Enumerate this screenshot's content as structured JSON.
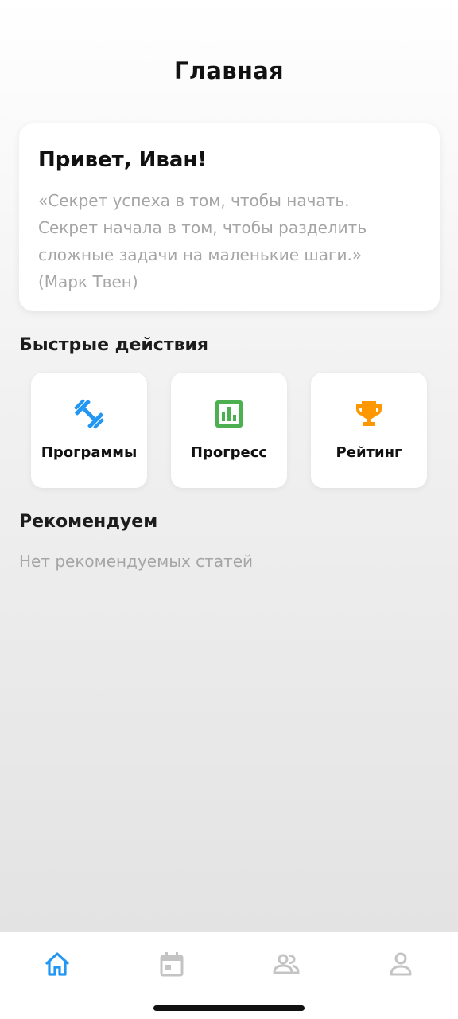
{
  "header": {
    "title": "Главная"
  },
  "greeting": {
    "title": "Привет, Иван!",
    "quote": "«Секрет успеха в том, чтобы начать. Секрет начала в том, чтобы разделить сложные задачи на маленькие шаги.» (Марк Твен)"
  },
  "quick_actions": {
    "title": "Быстрые действия",
    "items": [
      {
        "label": "Программы",
        "icon": "dumbbell-icon",
        "color": "#2196F3"
      },
      {
        "label": "Прогресс",
        "icon": "bar-chart-icon",
        "color": "#4CAF50"
      },
      {
        "label": "Рейтинг",
        "icon": "trophy-icon",
        "color": "#FF9800"
      }
    ]
  },
  "recommended": {
    "title": "Рекомендуем",
    "empty_text": "Нет рекомендуемых статей"
  },
  "tabbar": {
    "items": [
      {
        "icon": "home-icon",
        "active": true
      },
      {
        "icon": "calendar-icon",
        "active": false
      },
      {
        "icon": "people-icon",
        "active": false
      },
      {
        "icon": "profile-icon",
        "active": false
      }
    ],
    "active_color": "#2196F3",
    "inactive_color": "#c4c4c4"
  }
}
